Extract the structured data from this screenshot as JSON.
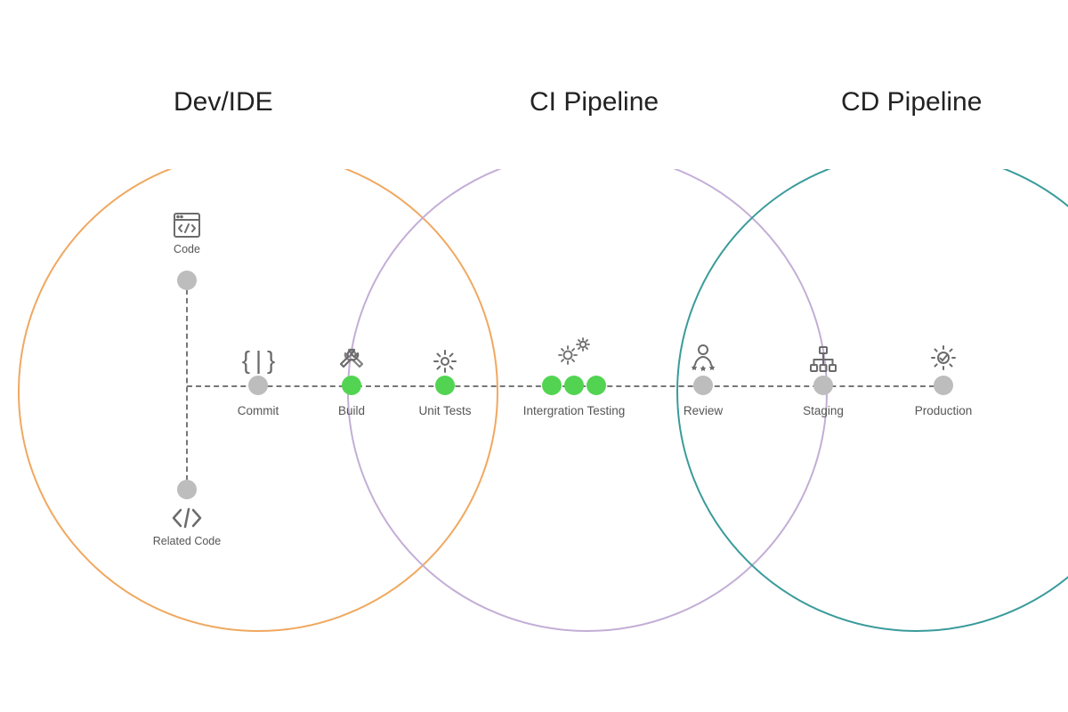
{
  "sections": {
    "dev": {
      "title": "Dev/IDE",
      "color": "#F0A860"
    },
    "ci": {
      "title": "CI Pipeline",
      "color": "#C3AED6"
    },
    "cd": {
      "title": "CD Pipeline",
      "color": "#3B9B9B"
    }
  },
  "code_top": {
    "label": "Code"
  },
  "code_bottom": {
    "label": "Related Code"
  },
  "steps": {
    "commit": {
      "label": "Commit",
      "dot": "grey",
      "dot_count": 1
    },
    "build": {
      "label": "Build",
      "dot": "green",
      "dot_count": 1
    },
    "unit": {
      "label": "Unit Tests",
      "dot": "green",
      "dot_count": 1
    },
    "integ": {
      "label": "Intergration Testing",
      "dot": "green",
      "dot_count": 3
    },
    "review": {
      "label": "Review",
      "dot": "grey",
      "dot_count": 1
    },
    "staging": {
      "label": "Staging",
      "dot": "grey",
      "dot_count": 1
    },
    "production": {
      "label": "Production",
      "dot": "grey",
      "dot_count": 1
    }
  },
  "colors": {
    "dot_grey": "#BDBDBD",
    "dot_green": "#52D452",
    "dash": "#777777",
    "icon": "#6b6b6b"
  }
}
